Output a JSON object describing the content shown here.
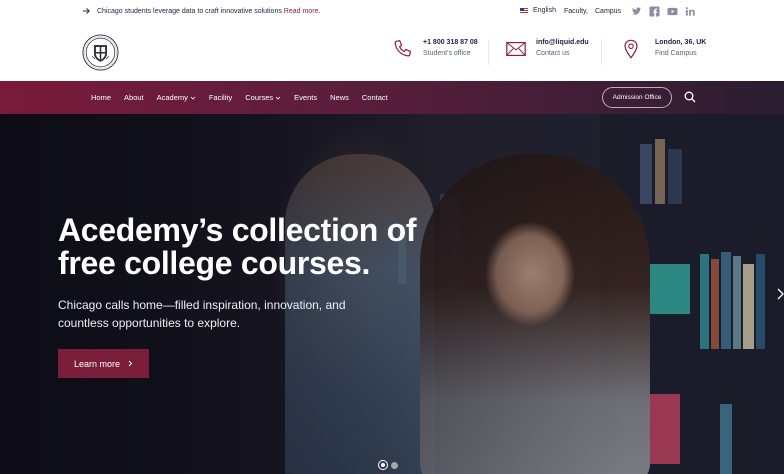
{
  "topbar": {
    "announcement": "Chicago students leverage data to craft innovative solutions",
    "read_more": "Read more.",
    "language": "English",
    "faculty": "Faculty,",
    "campus": "Campus",
    "social": [
      "twitter-icon",
      "facebook-icon",
      "youtube-icon",
      "linkedin-icon"
    ]
  },
  "header": {
    "phone": {
      "value": "+1 800 318 87 08",
      "label": "Student's office"
    },
    "email": {
      "value": "info@liquid.edu",
      "label": "Contact us"
    },
    "location": {
      "value": "London, 36, UK",
      "label": "Find Campus"
    }
  },
  "nav": {
    "items": [
      {
        "label": "Home"
      },
      {
        "label": "About"
      },
      {
        "label": "Academy"
      },
      {
        "label": "Facility"
      },
      {
        "label": "Courses"
      },
      {
        "label": "Events"
      },
      {
        "label": "News"
      },
      {
        "label": "Contact"
      }
    ],
    "admission": "Admission Office"
  },
  "hero": {
    "title_line1": "Acedemy’s collection of",
    "title_line2": "free college courses.",
    "subtitle_line1": "Chicago calls home—filled inspiration, innovation, and",
    "subtitle_line2": "countless opportunities to explore.",
    "button": "Learn more"
  },
  "colors": {
    "accent": "#7a1e3a",
    "nav_start": "#7a1a3a",
    "nav_end": "#2b1d30",
    "text_dark": "#1f2040"
  }
}
